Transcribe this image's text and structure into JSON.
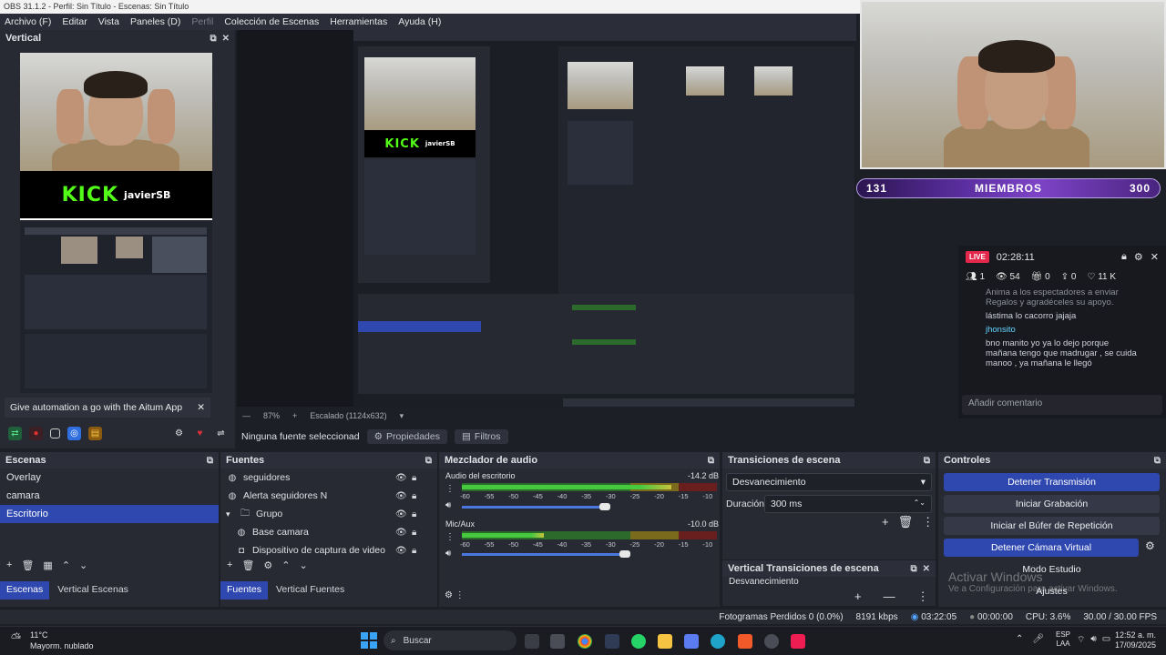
{
  "window_title": "OBS 31.1.2 - Perfil: Sin Título - Escenas: Sin Título",
  "menu": [
    {
      "label": "Archivo (F)",
      "dim": false
    },
    {
      "label": "Editar",
      "dim": false
    },
    {
      "label": "Vista",
      "dim": false
    },
    {
      "label": "Paneles (D)",
      "dim": false
    },
    {
      "label": "Perfil",
      "dim": true
    },
    {
      "label": "Colección de Escenas",
      "dim": false
    },
    {
      "label": "Herramientas",
      "dim": false
    },
    {
      "label": "Ayuda (H)",
      "dim": false
    }
  ],
  "vertical_dock": {
    "title": "Vertical",
    "notification": "Give automation a go with the Aitum App",
    "kick_text": "KICK",
    "kick_name": "javierSB"
  },
  "preview_status": {
    "zoom": "87%",
    "scale": "Escalado (1124x632)"
  },
  "source_toolbar": {
    "no_source": "Ninguna fuente seleccionad",
    "properties": "Propiedades",
    "filters": "Filtros"
  },
  "overlay": {
    "members_left": "131",
    "members_label": "MIEMBROS",
    "members_right": "300",
    "live_badge": "LIVE",
    "live_time": "02:28:11",
    "stats": [
      "1",
      "54",
      "0",
      "0",
      "11 K"
    ],
    "messages": [
      {
        "name": "",
        "text": "Anima a los espectadores a enviar Regalos y agradéceles su apoyo."
      },
      {
        "name": "",
        "text": "lástima lo cacorro jajaja"
      },
      {
        "name": "jhonsito",
        "text": "bno manito yo ya lo dejo porque mañana tengo que madrugar , se cuida manoo , ya mañana le llegó"
      }
    ],
    "comment_placeholder": "Añadir comentario"
  },
  "scenes": {
    "title": "Escenas",
    "items": [
      "Overlay",
      "camara",
      "Escritorio"
    ],
    "selected_index": 2,
    "tabs": [
      "Escenas",
      "Vertical Escenas"
    ]
  },
  "sources": {
    "title": "Fuentes",
    "items": [
      {
        "label": "seguidores",
        "icon": "globe-icon",
        "indent": 0
      },
      {
        "label": "Alerta seguidores N",
        "icon": "globe-icon",
        "indent": 0
      },
      {
        "label": "Grupo",
        "icon": "folder-icon",
        "indent": 0
      },
      {
        "label": "Base camara",
        "icon": "globe-icon",
        "indent": 1
      },
      {
        "label": "Dispositivo de captura de video",
        "icon": "camera-icon",
        "indent": 1
      }
    ],
    "tabs": [
      "Fuentes",
      "Vertical Fuentes"
    ]
  },
  "mixer": {
    "title": "Mezclador de audio",
    "channels": [
      {
        "name": "Audio del escritorio",
        "db": "-14.2 dB",
        "level": 0.82,
        "volume": 0.56
      },
      {
        "name": "Mic/Aux",
        "db": "-10.0 dB",
        "level": 0.32,
        "volume": 0.64
      }
    ],
    "ticks": [
      "-60",
      "-55",
      "-50",
      "-45",
      "-40",
      "-35",
      "-30",
      "-25",
      "-20",
      "-15",
      "-10",
      "-5",
      "0"
    ]
  },
  "transitions": {
    "title": "Transiciones de escena",
    "selected": "Desvanecimiento",
    "duration_label": "Duración",
    "duration_value": "300 ms",
    "vertical_title": "Vertical Transiciones de escena",
    "vertical_selected": "Desvanecimiento"
  },
  "controls": {
    "title": "Controles",
    "buttons": [
      {
        "label": "Detener Transmisión",
        "active": true
      },
      {
        "label": "Iniciar Grabación",
        "active": false
      },
      {
        "label": "Iniciar el Búfer de Repetición",
        "active": false
      },
      {
        "label": "Detener Cámara Virtual",
        "active": true
      },
      {
        "label": "Modo Estudio",
        "active": false
      },
      {
        "label": "Ajustes",
        "active": false
      }
    ],
    "activate_windows": "Activar Windows",
    "activate_windows_sub": "Ve a Configuración para activar Windows."
  },
  "statusbar": {
    "dropped": "Fotogramas Perdidos 0 (0.0%)",
    "bitrate": "8191 kbps",
    "stream_time": "03:22:05",
    "rec_time": "00:00:00",
    "cpu": "CPU: 3.6%",
    "fps": "30.00 / 30.00 FPS"
  },
  "taskbar": {
    "weather_temp": "11°C",
    "weather_desc": "Mayorm. nublado",
    "search": "Buscar",
    "lang1": "ESP",
    "lang2": "LAA",
    "time": "12:52 a. m.",
    "date": "17/09/2025"
  },
  "colors": {
    "accent": "#2f48b0",
    "kick": "#53fc18",
    "live": "#e4284c"
  }
}
